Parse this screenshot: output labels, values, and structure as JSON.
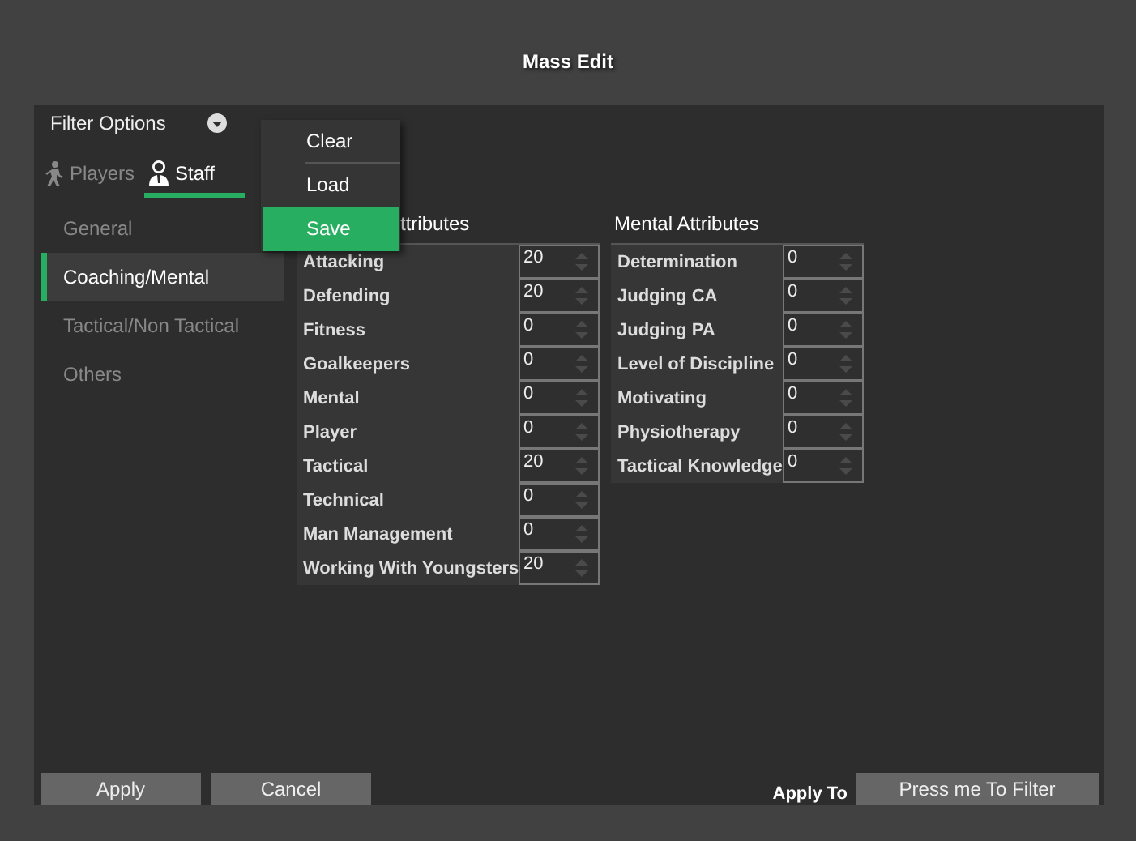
{
  "window": {
    "title": "Mass Edit"
  },
  "filter_options": {
    "label": "Filter Options"
  },
  "menu": {
    "items": [
      {
        "label": "Clear",
        "selected": false
      },
      {
        "label": "Load",
        "selected": false
      },
      {
        "label": "Save",
        "selected": true
      }
    ]
  },
  "tabs": [
    {
      "label": "Players",
      "selected": false
    },
    {
      "label": "Staff",
      "selected": true
    }
  ],
  "sidebar": {
    "items": [
      {
        "label": "General",
        "selected": false
      },
      {
        "label": "Coaching/Mental",
        "selected": true
      },
      {
        "label": "Tactical/Non Tactical",
        "selected": false
      },
      {
        "label": "Others",
        "selected": false
      }
    ]
  },
  "groups": [
    {
      "title": "ttributes",
      "rows": [
        {
          "label": "Attacking",
          "value": "20"
        },
        {
          "label": "Defending",
          "value": "20"
        },
        {
          "label": "Fitness",
          "value": "0"
        },
        {
          "label": "Goalkeepers",
          "value": "0"
        },
        {
          "label": "Mental",
          "value": "0"
        },
        {
          "label": "Player",
          "value": "0"
        },
        {
          "label": "Tactical",
          "value": "20"
        },
        {
          "label": "Technical",
          "value": "0"
        },
        {
          "label": "Man Management",
          "value": "0"
        },
        {
          "label": "Working With Youngsters",
          "value": "20"
        }
      ]
    },
    {
      "title": "Mental Attributes",
      "rows": [
        {
          "label": "Determination",
          "value": "0"
        },
        {
          "label": "Judging CA",
          "value": "0"
        },
        {
          "label": "Judging PA",
          "value": "0"
        },
        {
          "label": "Level of Discipline",
          "value": "0"
        },
        {
          "label": "Motivating",
          "value": "0"
        },
        {
          "label": "Physiotherapy",
          "value": "0"
        },
        {
          "label": "Tactical Knowledge",
          "value": "0"
        }
      ]
    }
  ],
  "footer": {
    "buttons": [
      "Apply",
      "Cancel"
    ],
    "apply_to_label": "Apply To",
    "filter_button": "Press me To Filter"
  }
}
